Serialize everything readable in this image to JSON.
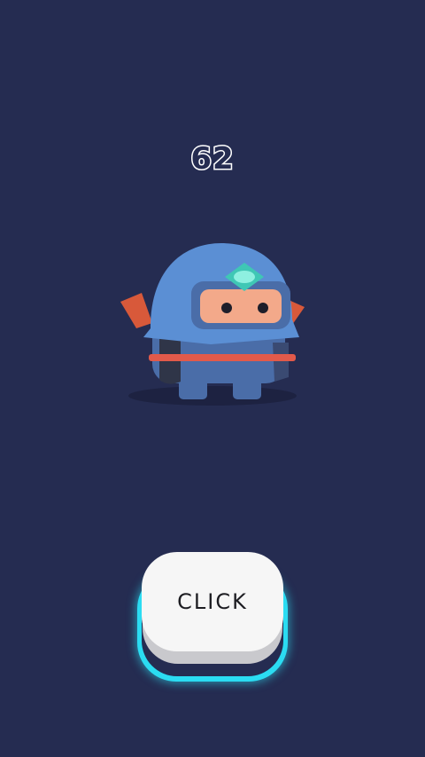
{
  "game": {
    "score": "62",
    "button_label": "CLICK",
    "character_name": "ninja-character"
  },
  "colors": {
    "background": "#252c51",
    "hood": "#5b8fd4",
    "body": "#4a6da8",
    "face": "#f3a98a",
    "gem": "#6fe6d2",
    "sword": "#d8593a",
    "belt": "#e25a4a",
    "button_face": "#f6f6f6",
    "button_glow": "#2bdcf2"
  }
}
